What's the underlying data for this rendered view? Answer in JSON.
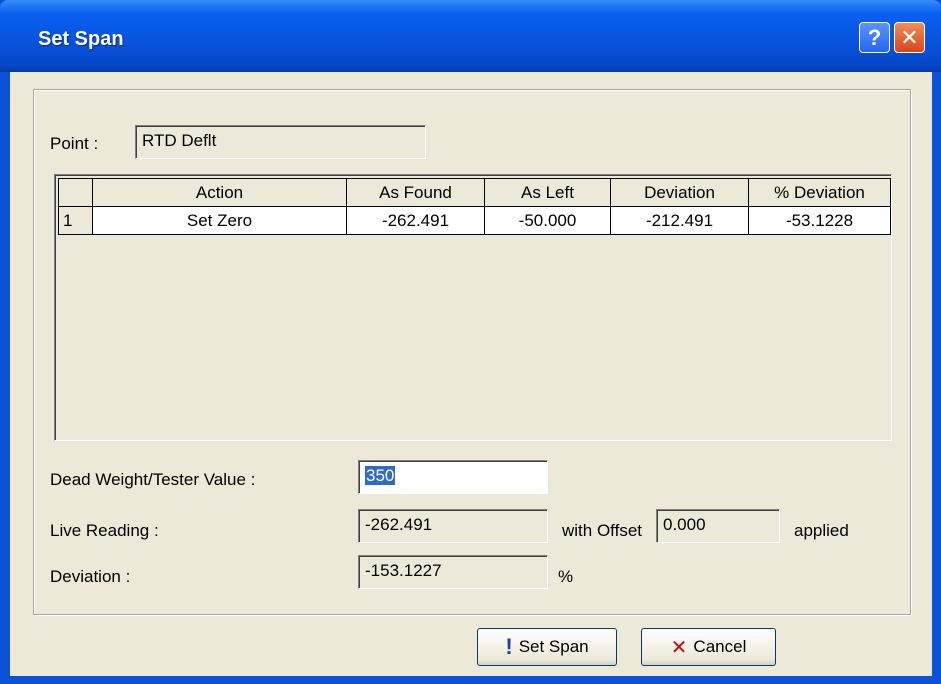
{
  "window": {
    "title": "Set Span",
    "help_glyph": "?",
    "close_glyph": "✕"
  },
  "point": {
    "label": "Point :",
    "value": "RTD Deflt"
  },
  "table": {
    "columns": [
      "",
      "Action",
      "As Found",
      "As Left",
      "Deviation",
      "% Deviation"
    ],
    "rows": [
      [
        "1",
        "Set Zero",
        "-262.491",
        "-50.000",
        "-212.491",
        "-53.1228"
      ]
    ]
  },
  "form": {
    "dead_weight_label": "Dead Weight/Tester Value :",
    "dead_weight_value": "350",
    "live_reading_label": "Live Reading :",
    "live_reading_value": "-262.491",
    "with_offset_label": "with Offset",
    "offset_value": "0.000",
    "applied_label": "applied",
    "deviation_label": "Deviation :",
    "deviation_value": "-153.1227",
    "percent_label": "%"
  },
  "buttons": {
    "set_span_label": "Set Span",
    "set_span_icon": "exclamation-icon",
    "cancel_label": "Cancel",
    "cancel_icon": "x-icon"
  },
  "colors": {
    "titlebar": "#0754e0",
    "dialog_bg": "#ece9d8",
    "selection": "#316ac5"
  }
}
